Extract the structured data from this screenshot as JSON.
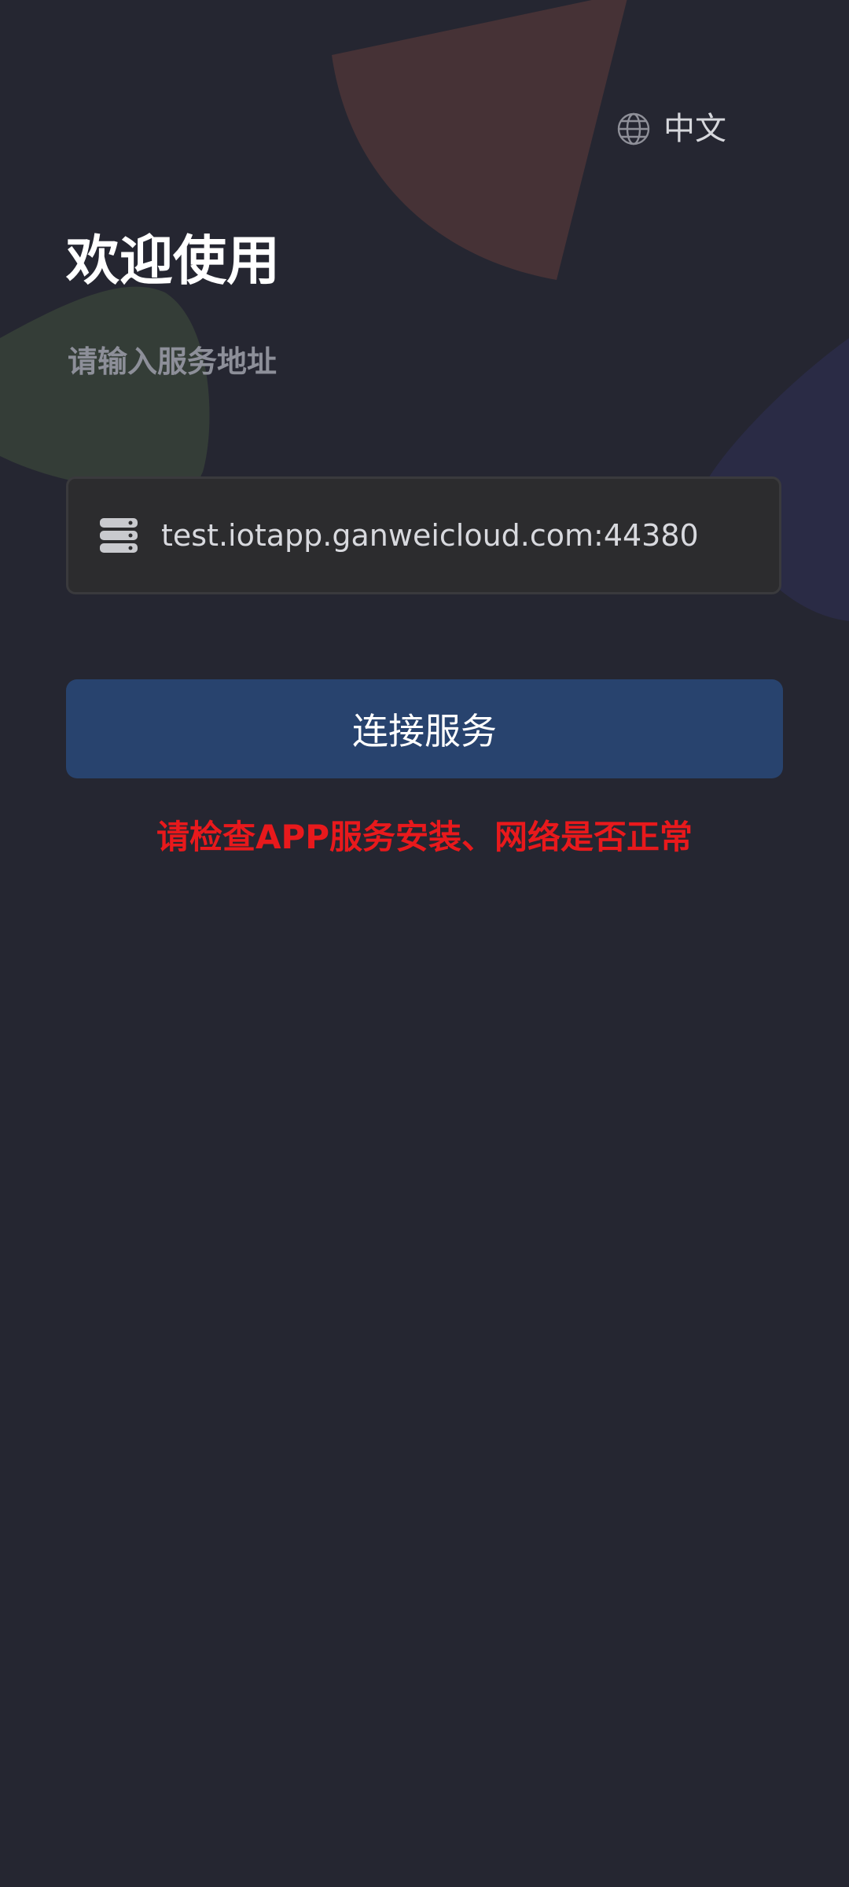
{
  "language": {
    "icon": "globe-icon",
    "label": "中文"
  },
  "welcome": {
    "title": "欢迎使用",
    "subtitle": "请输入服务地址"
  },
  "server": {
    "icon": "server-icon",
    "value": "test.iotapp.ganweicloud.com:44380"
  },
  "connect": {
    "label": "连接服务"
  },
  "error": {
    "message": "请检查APP服务安装、网络是否正常"
  },
  "colors": {
    "background": "#252631",
    "primary_button": "#28436e",
    "error": "#e8191c",
    "decor_red": "#463236",
    "decor_green": "#343d37",
    "decor_blue": "#2a2b45"
  }
}
